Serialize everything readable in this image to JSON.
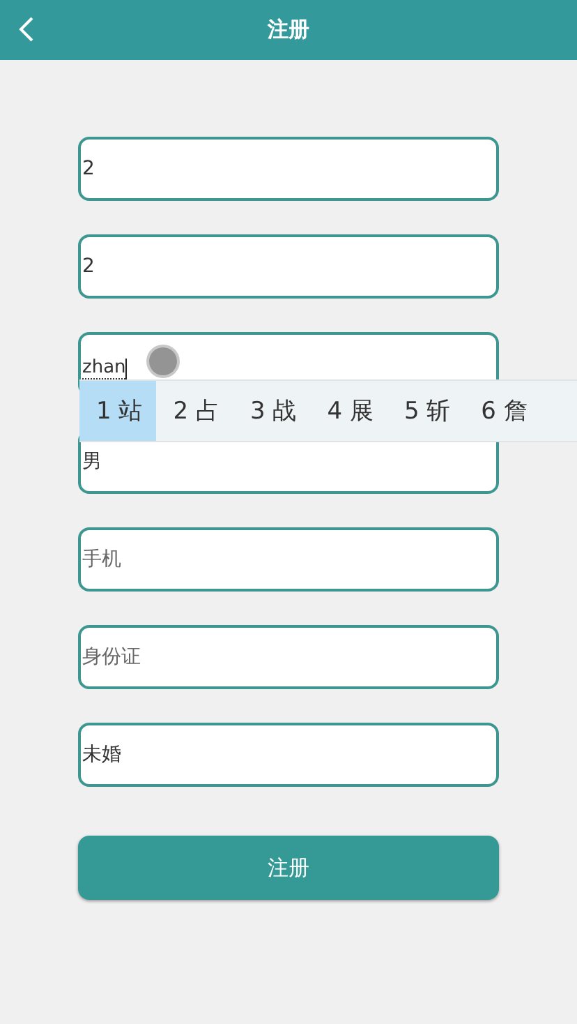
{
  "header": {
    "title": "注册"
  },
  "fields": [
    {
      "value": "2"
    },
    {
      "value": "2"
    },
    {
      "value": "zhan",
      "composing": true
    },
    {
      "value": "男"
    },
    {
      "placeholder": "手机"
    },
    {
      "placeholder": "身份证"
    },
    {
      "value": "未婚"
    }
  ],
  "ime_candidates": [
    {
      "label": "1 站",
      "selected": true
    },
    {
      "label": "2 占",
      "selected": false
    },
    {
      "label": "3 战",
      "selected": false
    },
    {
      "label": "4 展",
      "selected": false
    },
    {
      "label": "5 斩",
      "selected": false
    },
    {
      "label": "6 詹",
      "selected": false
    }
  ],
  "submit_button": "注册"
}
